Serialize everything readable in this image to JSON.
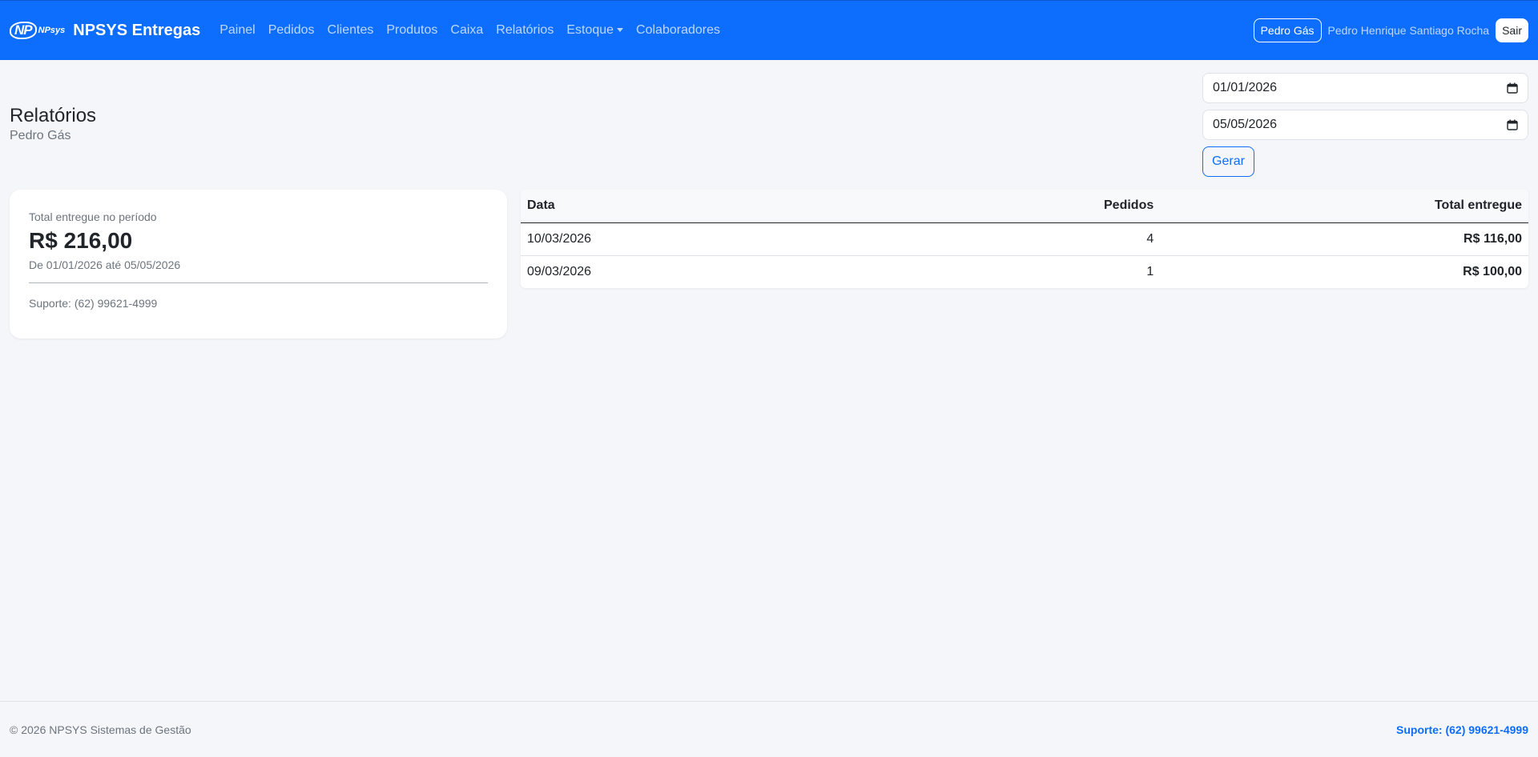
{
  "navbar": {
    "logo_mark": "NP",
    "logo_text": "NPsys",
    "brand": "NPSYS Entregas",
    "links": [
      {
        "label": "Painel"
      },
      {
        "label": "Pedidos"
      },
      {
        "label": "Clientes"
      },
      {
        "label": "Produtos"
      },
      {
        "label": "Caixa"
      },
      {
        "label": "Relatórios"
      },
      {
        "label": "Estoque"
      },
      {
        "label": "Colaboradores"
      }
    ],
    "company": "Pedro Gás",
    "user": "Pedro Henrique Santiago Rocha",
    "logout": "Sair"
  },
  "header": {
    "title": "Relatórios",
    "subtitle": "Pedro Gás"
  },
  "filters": {
    "start_date": "01/01/2026",
    "end_date": "05/05/2026",
    "generate_label": "Gerar"
  },
  "summary": {
    "label": "Total entregue no período",
    "value": "R$ 216,00",
    "range": "De 01/01/2026 até 05/05/2026",
    "support": "Suporte: (62) 99621-4999"
  },
  "table": {
    "headers": {
      "date": "Data",
      "orders": "Pedidos",
      "total": "Total entregue"
    },
    "rows": [
      {
        "date": "10/03/2026",
        "orders": "4",
        "total": "R$ 116,00"
      },
      {
        "date": "09/03/2026",
        "orders": "1",
        "total": "R$ 100,00"
      }
    ]
  },
  "footer": {
    "copyright": "© 2026 NPSYS Sistemas de Gestão",
    "support": "Suporte: (62) 99621-4999"
  },
  "colors": {
    "primary": "#0d6efd",
    "background": "#f5f6f9"
  }
}
